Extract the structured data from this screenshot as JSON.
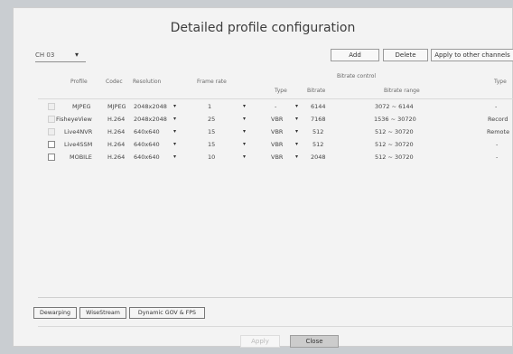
{
  "dialog": {
    "title": "Detailed profile configuration",
    "channel": "CH 03",
    "buttons": {
      "add": "Add",
      "delete": "Delete",
      "apply_other": "Apply to other channels"
    },
    "bottom_tabs": [
      "Dewarping",
      "WiseStream",
      "Dynamic GOV & FPS"
    ],
    "footer": {
      "apply": "Apply",
      "close": "Close"
    }
  },
  "table": {
    "headers": {
      "profile": "Profile",
      "codec": "Codec",
      "resolution": "Resolution",
      "frame_rate": "Frame rate",
      "bitrate_control": "Bitrate control",
      "type": "Type",
      "bitrate": "Bitrate",
      "bitrate_range": "Bitrate range",
      "type2": "Type"
    },
    "rows": [
      {
        "profile": "MJPEG",
        "codec": "MJPEG",
        "resolution": "2048x2048",
        "frame_rate": "1",
        "bit_type": "-",
        "bitrate": "6144",
        "bitrate_range": "3072 ~ 6144",
        "type": "-"
      },
      {
        "profile": "FisheyeView",
        "codec": "H.264",
        "resolution": "2048x2048",
        "frame_rate": "25",
        "bit_type": "VBR",
        "bitrate": "7168",
        "bitrate_range": "1536 ~ 30720",
        "type": "Record"
      },
      {
        "profile": "Live4NVR",
        "codec": "H.264",
        "resolution": "640x640",
        "frame_rate": "15",
        "bit_type": "VBR",
        "bitrate": "512",
        "bitrate_range": "512 ~ 30720",
        "type": "Remote"
      },
      {
        "profile": "Live4SSM",
        "codec": "H.264",
        "resolution": "640x640",
        "frame_rate": "15",
        "bit_type": "VBR",
        "bitrate": "512",
        "bitrate_range": "512 ~ 30720",
        "type": "-"
      },
      {
        "profile": "MOBILE",
        "codec": "H.264",
        "resolution": "640x640",
        "frame_rate": "10",
        "bit_type": "VBR",
        "bitrate": "2048",
        "bitrate_range": "512 ~ 30720",
        "type": "-"
      }
    ]
  },
  "icons": {
    "dropdown": "▾"
  }
}
